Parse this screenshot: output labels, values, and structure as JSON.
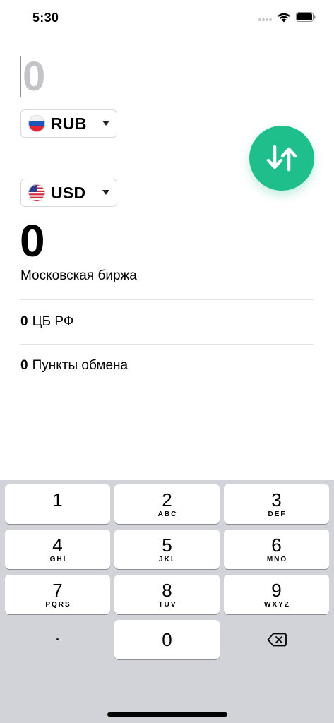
{
  "status_bar": {
    "time": "5:30"
  },
  "converter": {
    "source": {
      "amount": "0",
      "currency": "RUB"
    },
    "target": {
      "amount": "0",
      "currency": "USD"
    },
    "rate_source_label": "Московская биржа",
    "rates": [
      {
        "value": "0",
        "label": "ЦБ РФ"
      },
      {
        "value": "0",
        "label": "Пункты обмена"
      }
    ]
  },
  "colors": {
    "accent": "#1ebf8b",
    "keypad_bg": "#d1d3d9",
    "placeholder": "#c3c3c8"
  },
  "keypad": {
    "keys": [
      {
        "digit": "1",
        "letters": ""
      },
      {
        "digit": "2",
        "letters": "ABC"
      },
      {
        "digit": "3",
        "letters": "DEF"
      },
      {
        "digit": "4",
        "letters": "GHI"
      },
      {
        "digit": "5",
        "letters": "JKL"
      },
      {
        "digit": "6",
        "letters": "MNO"
      },
      {
        "digit": "7",
        "letters": "PQRS"
      },
      {
        "digit": "8",
        "letters": "TUV"
      },
      {
        "digit": "9",
        "letters": "WXYZ"
      }
    ],
    "zero": "0",
    "decimal": ".",
    "backspace_icon": "backspace-icon"
  }
}
